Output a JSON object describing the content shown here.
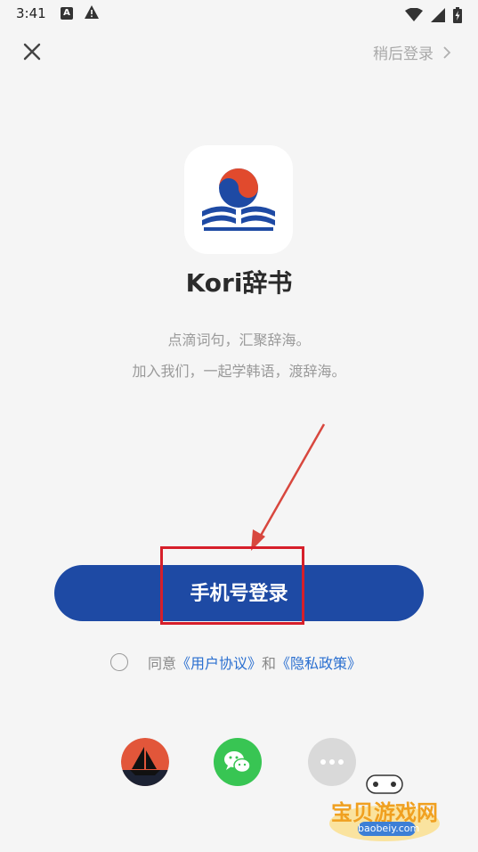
{
  "status_bar": {
    "time": "3:41"
  },
  "header": {
    "skip_label": "稍后登录"
  },
  "app": {
    "name": "Kori辞书",
    "tagline_1": "点滴词句，汇聚辞海。",
    "tagline_2": "加入我们，一起学韩语，渡辞海。"
  },
  "login": {
    "phone_button_label": "手机号登录"
  },
  "agreement": {
    "prefix": "同意",
    "user_agreement": "《用户协议》",
    "and": "和",
    "privacy_policy": "《隐私政策》"
  },
  "social_icons": [
    "boat-icon",
    "wechat-icon",
    "more-icon"
  ],
  "watermark": {
    "text": "宝贝游戏网",
    "url": "baobeiy.com"
  },
  "colors": {
    "primary": "#1e4aa4",
    "link": "#2a6fd0",
    "wechat": "#38c553",
    "highlight": "#d61f2a"
  }
}
